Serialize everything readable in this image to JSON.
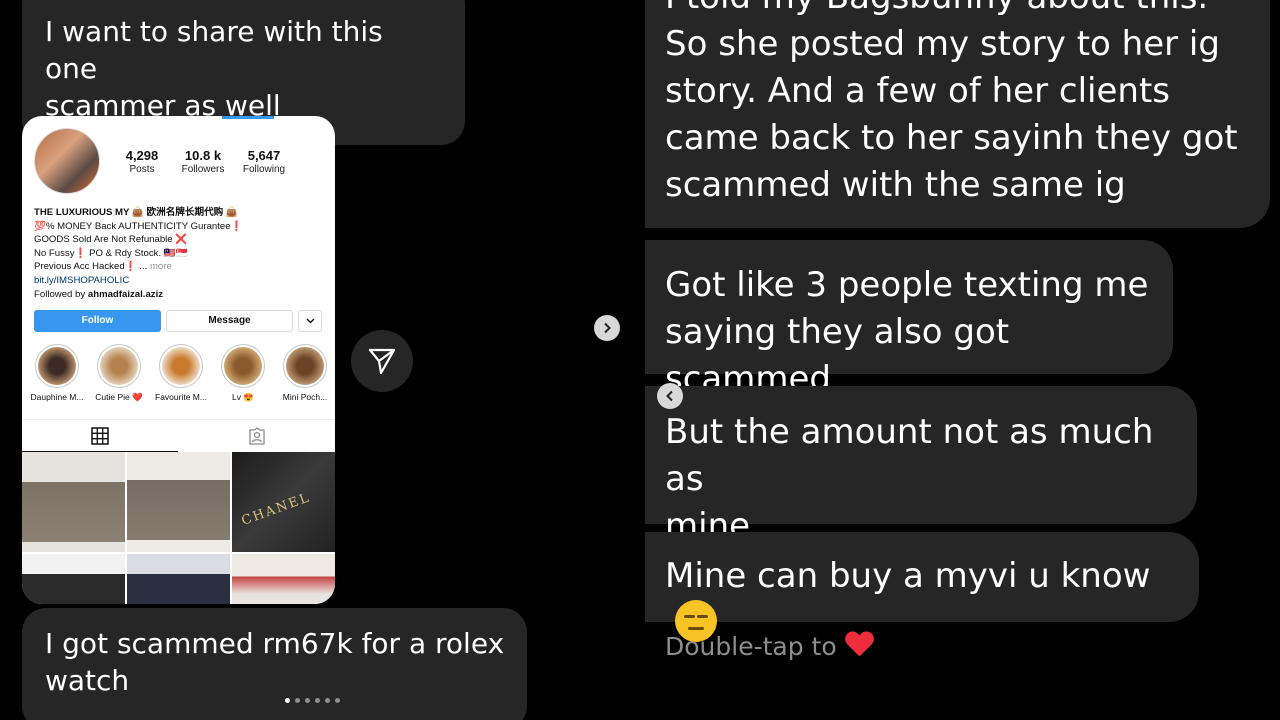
{
  "left": {
    "share_message": [
      "I want to share with this one",
      "scammer as well"
    ],
    "scammed_message": [
      "I got scammed rm67k for a rolex",
      "watch"
    ],
    "profile": {
      "stats": [
        {
          "value": "4,298",
          "label": "Posts"
        },
        {
          "value": "10.8 k",
          "label": "Followers"
        },
        {
          "value": "5,647",
          "label": "Following"
        }
      ],
      "bio_name": "THE LUXURIOUS MY 👜 欧洲名牌长期代购 👜",
      "bio_lines": [
        "💯% MONEY Back AUTHENTICITY Gurantee❗",
        "GOODS Sold Are Not Refunable ❌",
        "No Fussy❗ PO & Rdy Stock. 🇲🇾🇸🇬",
        "Previous Acc Hacked❗ ..."
      ],
      "bio_more": "more",
      "bio_link": "bit.ly/IMSHOPAHOLIC",
      "followed_by_prefix": "Followed by",
      "followed_by_name": "ahmadfaizal.aziz",
      "follow_label": "Follow",
      "message_label": "Message",
      "highlights": [
        "Dauphine M...",
        "Cutie Pie ❤️",
        "Favourite M...",
        "Lv 😍",
        "Mini Poch..."
      ],
      "grid_text": "CHANEL"
    },
    "carousel": {
      "count": 6,
      "active": 0
    }
  },
  "right": {
    "bagsbunny_partial": "I told my Bagsbunny about this.",
    "bagsbunny_message": [
      "So she posted my story to her ig",
      "story. And a few of her clients",
      "came back to her sayinh they got",
      "scammed with the same ig"
    ],
    "people_message": [
      "Got like 3 people texting me",
      "saying they also got scammed"
    ],
    "amount_message": [
      "But the amount not as much as",
      "mine"
    ],
    "myvi_message": "Mine can buy a myvi u know",
    "double_tap": "Double-tap to"
  },
  "colors": {
    "bubble": "#262626",
    "follow_blue": "#3797f0",
    "heart": "#ed2d3b"
  },
  "icons": [
    "send-icon",
    "chevron-right-icon",
    "chevron-left-icon",
    "grid-icon",
    "tagged-icon",
    "heart-icon",
    "neutral-face-emoji"
  ]
}
